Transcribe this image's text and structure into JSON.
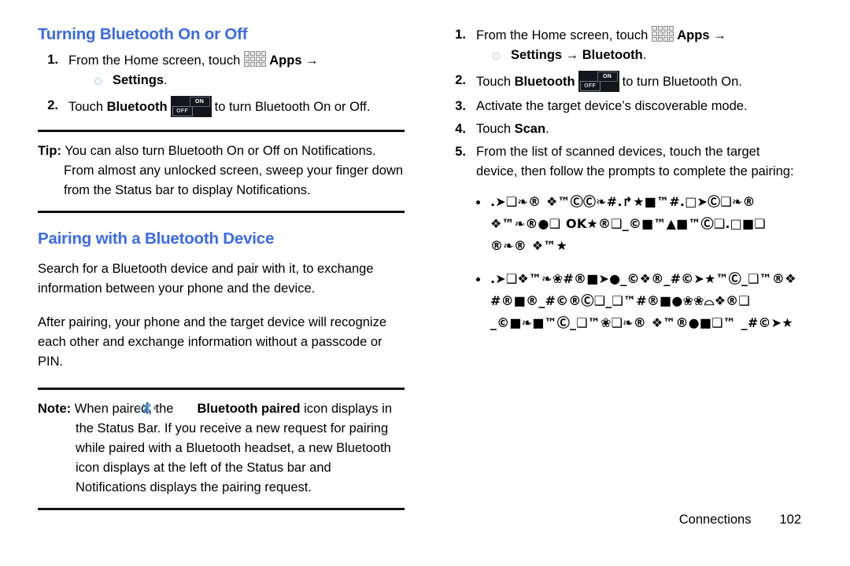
{
  "colors": {
    "heading_blue": "#3b6ae8",
    "rule_black": "#111111",
    "bullet_ring": "#9fc6dd",
    "toggle_body": "#14161c",
    "bluetooth_blue": "#2f7fd0"
  },
  "left_column": {
    "heading_1": "Turning Bluetooth On or Off",
    "steps": [
      {
        "number": "1.",
        "text_before_icon": "From the Home screen, touch",
        "icon": "apps-grid-icon",
        "bold_label": "Apps",
        "arrow": "→",
        "sub_bullet": {
          "bold": "Settings",
          "plain": "."
        }
      },
      {
        "number": "2.",
        "text_before_bold": "Touch",
        "bold_label": "Bluetooth",
        "icon": "on-off-toggle-icon",
        "text_after_icon": "to turn Bluetooth On or Off."
      }
    ],
    "tip": {
      "label": "Tip:",
      "body": "You can also turn Bluetooth On or Off on Notifications. From almost any unlocked screen, sweep your finger down from the Status bar to display Notifications."
    },
    "heading_2": "Pairing with a Bluetooth Device",
    "paragraph_1": "Search for a Bluetooth device and pair with it, to exchange information between your phone and the device.",
    "paragraph_2": "After pairing, your phone and the target device will recognize each other and exchange information without a passcode or PIN.",
    "note": {
      "label": "Note:",
      "text_before_icon": "When paired, the",
      "icon": "bluetooth-paired-icon",
      "bold_label": "Bluetooth paired",
      "text_after_icon": "icon displays in the Status Bar. If you receive a new request for pairing while paired with a Bluetooth headset, a new Bluetooth icon displays at the left of the Status bar and Notifications displays the pairing request."
    }
  },
  "right_column": {
    "steps": [
      {
        "number": "1.",
        "text_before_icon": "From the Home screen, touch",
        "icon": "apps-grid-icon",
        "bold_label": "Apps",
        "arrow": "→",
        "sub_bullet": {
          "bold": "Settings → Bluetooth",
          "plain": "."
        }
      },
      {
        "number": "2.",
        "text_before_bold": "Touch",
        "bold_label": "Bluetooth",
        "icon": "on-off-toggle-icon",
        "text_after_icon": "to turn Bluetooth On."
      },
      {
        "number": "3.",
        "text": "Activate the target device’s discoverable mode."
      },
      {
        "number": "4.",
        "text_before_bold": "Touch",
        "bold_label": "Scan",
        "text_after_bold": "."
      },
      {
        "number": "5.",
        "text": "From the list of scanned devices, touch the target device, then follow the prompts to complete the pairing:"
      }
    ],
    "bullets": [
      ".➤❑❧® ❖™ⒸⒸ❧#.↱★■™#.□➤Ⓒ❑❧® ❖™❧®●❑   OK★®❑_©■™▲■™Ⓒ❑.□■❑ ®❧® ❖™★",
      ".➤❑❖™❧❀#®■➤●_©❖®_#©➤★™Ⓒ_❑™®❖ #®■®_#©®Ⓒ❑_❑™#®■●❀❀⌓❖®❑ _©■❧■™Ⓒ_❑™❀❑❧® ❖™®●■❑™ _#©➤★"
    ]
  },
  "footer": {
    "chapter": "Connections",
    "page_number": "102"
  }
}
